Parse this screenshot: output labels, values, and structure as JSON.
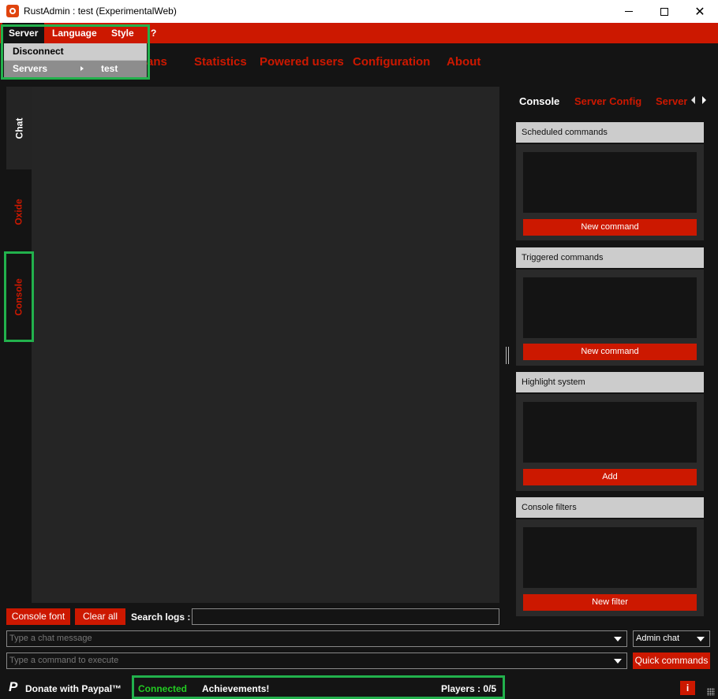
{
  "window": {
    "app_name": "RustAdmin",
    "title_suffix": " : test (ExperimentalWeb)",
    "minimize": "",
    "maximize": "",
    "close": "✕"
  },
  "menu": {
    "items": [
      "Server",
      "Language",
      "Style",
      "?"
    ]
  },
  "server_dropdown": {
    "disconnect": "Disconnect",
    "servers": "Servers",
    "servers_submenu_item": "test"
  },
  "main_nav": {
    "tabs": [
      "ans",
      "Statistics",
      "Powered users",
      "Configuration",
      "About"
    ]
  },
  "left_tabs": {
    "items": [
      "Chat",
      "Oxide",
      "Console"
    ],
    "active": "Chat"
  },
  "right_panel": {
    "tabs": [
      "Console",
      "Server Config",
      "Server"
    ],
    "active_tab": "Console",
    "sections": [
      {
        "title": "Scheduled commands",
        "button": "New command"
      },
      {
        "title": "Triggered commands",
        "button": "New command"
      },
      {
        "title": "Highlight system",
        "button": "Add"
      },
      {
        "title": "Console filters",
        "button": "New filter"
      }
    ]
  },
  "bottom": {
    "console_font": "Console font",
    "clear_all": "Clear all",
    "search_label": "Search logs :",
    "search_value": "",
    "chat_placeholder": "Type a chat message",
    "chat_target": "Admin chat",
    "command_placeholder": "Type a command to execute",
    "quick_commands": "Quick commands"
  },
  "status": {
    "donate": "Donate with Paypal™",
    "connected": "Connected",
    "achievements": "Achievements!",
    "players": "Players : 0/5",
    "info": "i"
  },
  "colors": {
    "accent": "#cc1800",
    "background": "#141414",
    "panel": "#252525",
    "status_ok": "#22cc22",
    "highlight": "#22b14c"
  }
}
